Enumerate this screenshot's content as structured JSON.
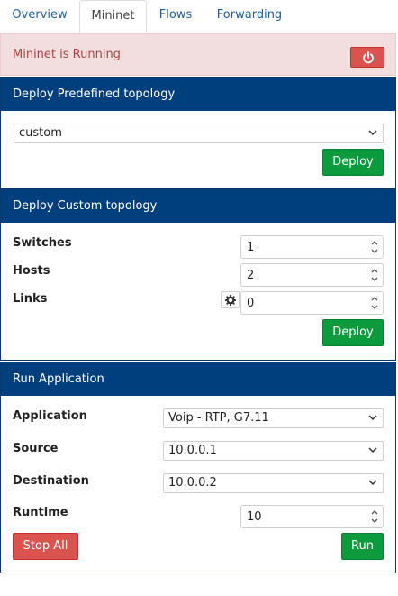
{
  "tabs": [
    {
      "label": "Overview",
      "active": false
    },
    {
      "label": "Mininet",
      "active": true
    },
    {
      "label": "Flows",
      "active": false
    },
    {
      "label": "Forwarding",
      "active": false
    }
  ],
  "alert": {
    "text": "Mininet is Running",
    "icon": "power-icon"
  },
  "predefined": {
    "title": "Deploy Predefined topology",
    "selected": "custom",
    "deploy_label": "Deploy"
  },
  "custom": {
    "title": "Deploy Custom topology",
    "switches_label": "Switches",
    "switches_value": "1",
    "hosts_label": "Hosts",
    "hosts_value": "2",
    "links_label": "Links",
    "links_value": "0",
    "deploy_label": "Deploy"
  },
  "app": {
    "title": "Run Application",
    "application_label": "Application",
    "application_value": "Voip - RTP, G7.11",
    "source_label": "Source",
    "source_value": "10.0.0.1",
    "destination_label": "Destination",
    "destination_value": "10.0.0.2",
    "runtime_label": "Runtime",
    "runtime_value": "10",
    "stop_label": "Stop All",
    "run_label": "Run"
  },
  "colors": {
    "panel_heading": "#003f7d",
    "alert_bg": "#f2dede",
    "alert_text": "#a94442",
    "success": "#0c9b3c",
    "danger": "#d9534f",
    "tab_link": "#1f5fa0"
  }
}
